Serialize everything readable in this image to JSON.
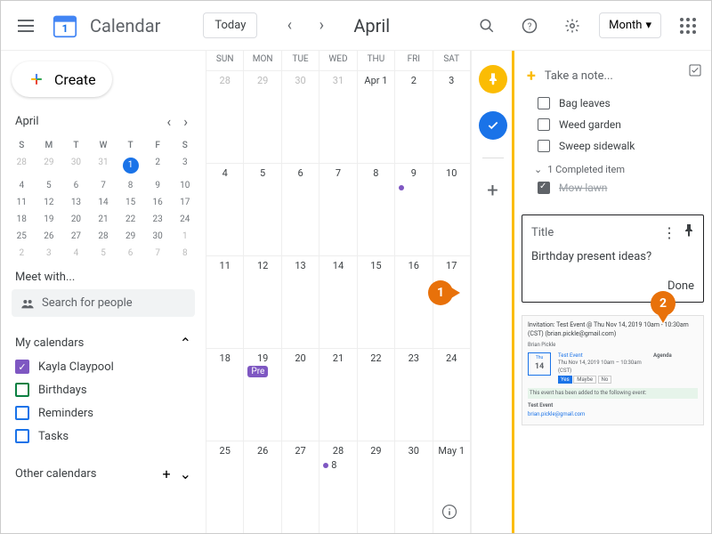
{
  "header": {
    "app_title": "Calendar",
    "today_label": "Today",
    "month_label": "April",
    "view_label": "Month"
  },
  "sidebar": {
    "create_label": "Create",
    "mini_month": "April",
    "mini_day_heads": [
      "S",
      "M",
      "T",
      "W",
      "T",
      "F",
      "S"
    ],
    "mini_weeks": [
      [
        {
          "n": "28",
          "o": true
        },
        {
          "n": "29",
          "o": true
        },
        {
          "n": "30",
          "o": true
        },
        {
          "n": "31",
          "o": true
        },
        {
          "n": "1",
          "t": true
        },
        {
          "n": "2"
        },
        {
          "n": "3"
        }
      ],
      [
        {
          "n": "4"
        },
        {
          "n": "5"
        },
        {
          "n": "6"
        },
        {
          "n": "7"
        },
        {
          "n": "8"
        },
        {
          "n": "9"
        },
        {
          "n": "10"
        }
      ],
      [
        {
          "n": "11"
        },
        {
          "n": "12"
        },
        {
          "n": "13"
        },
        {
          "n": "14"
        },
        {
          "n": "15"
        },
        {
          "n": "16"
        },
        {
          "n": "17"
        }
      ],
      [
        {
          "n": "18"
        },
        {
          "n": "19"
        },
        {
          "n": "20"
        },
        {
          "n": "21"
        },
        {
          "n": "22"
        },
        {
          "n": "23"
        },
        {
          "n": "24"
        }
      ],
      [
        {
          "n": "25"
        },
        {
          "n": "26"
        },
        {
          "n": "27"
        },
        {
          "n": "28"
        },
        {
          "n": "29"
        },
        {
          "n": "30"
        },
        {
          "n": "1",
          "o": true
        }
      ],
      [
        {
          "n": "2",
          "o": true
        },
        {
          "n": "3",
          "o": true
        },
        {
          "n": "4",
          "o": true
        },
        {
          "n": "5",
          "o": true
        },
        {
          "n": "6",
          "o": true
        },
        {
          "n": "7",
          "o": true
        },
        {
          "n": "8",
          "o": true
        }
      ]
    ],
    "meet_label": "Meet with...",
    "search_placeholder": "Search for people",
    "my_calendars_label": "My calendars",
    "calendars": [
      {
        "label": "Kayla Claypool",
        "color": "#7e57c2",
        "checked": true
      },
      {
        "label": "Birthdays",
        "color": "#0b8043",
        "checked": false
      },
      {
        "label": "Reminders",
        "color": "#1a73e8",
        "checked": false
      },
      {
        "label": "Tasks",
        "color": "#1a73e8",
        "checked": false
      }
    ],
    "other_calendars_label": "Other calendars"
  },
  "main": {
    "day_heads": [
      "SUN",
      "MON",
      "TUE",
      "WED",
      "THU",
      "FRI",
      "SAT"
    ],
    "weeks": [
      [
        {
          "n": "28",
          "o": true
        },
        {
          "n": "29",
          "o": true
        },
        {
          "n": "30",
          "o": true
        },
        {
          "n": "31",
          "o": true
        },
        {
          "n": "Apr 1"
        },
        {
          "n": "2"
        },
        {
          "n": "3"
        }
      ],
      [
        {
          "n": "4"
        },
        {
          "n": "5"
        },
        {
          "n": "6"
        },
        {
          "n": "7"
        },
        {
          "n": "8"
        },
        {
          "n": "9",
          "dot": true
        },
        {
          "n": "10"
        }
      ],
      [
        {
          "n": "11"
        },
        {
          "n": "12"
        },
        {
          "n": "13"
        },
        {
          "n": "14"
        },
        {
          "n": "15"
        },
        {
          "n": "16"
        },
        {
          "n": "17"
        }
      ],
      [
        {
          "n": "18"
        },
        {
          "n": "19",
          "chip": "Pre"
        },
        {
          "n": "20"
        },
        {
          "n": "21"
        },
        {
          "n": "22"
        },
        {
          "n": "23"
        },
        {
          "n": "24"
        }
      ],
      [
        {
          "n": "25"
        },
        {
          "n": "26"
        },
        {
          "n": "27"
        },
        {
          "n": "28",
          "dot": true,
          "dn": "8"
        },
        {
          "n": "29"
        },
        {
          "n": "30"
        },
        {
          "n": "May 1"
        }
      ]
    ]
  },
  "keep": {
    "take_note": "Take a note...",
    "items": [
      "Bag leaves",
      "Weed garden",
      "Sweep sidewalk"
    ],
    "completed_label": "1 Completed item",
    "completed_items": [
      "Mow lawn"
    ],
    "note": {
      "title_placeholder": "Title",
      "body": "Birthday present ideas?",
      "done_label": "Done"
    },
    "email": {
      "subject": "Invitation: Test Event @ Thu Nov 14, 2019 10am - 10:30am (CST) (brian.pickle@gmail.com)",
      "from": "Brian Pickle",
      "event_title": "Test Event",
      "date_num": "14",
      "when": "Thu Nov 14, 2019 10am – 10:30am (CST)",
      "agenda": "Agenda",
      "green_text": "This event has been added to the following event:",
      "event_name": "Test Event"
    }
  },
  "callouts": {
    "c1": "1",
    "c2": "2"
  }
}
